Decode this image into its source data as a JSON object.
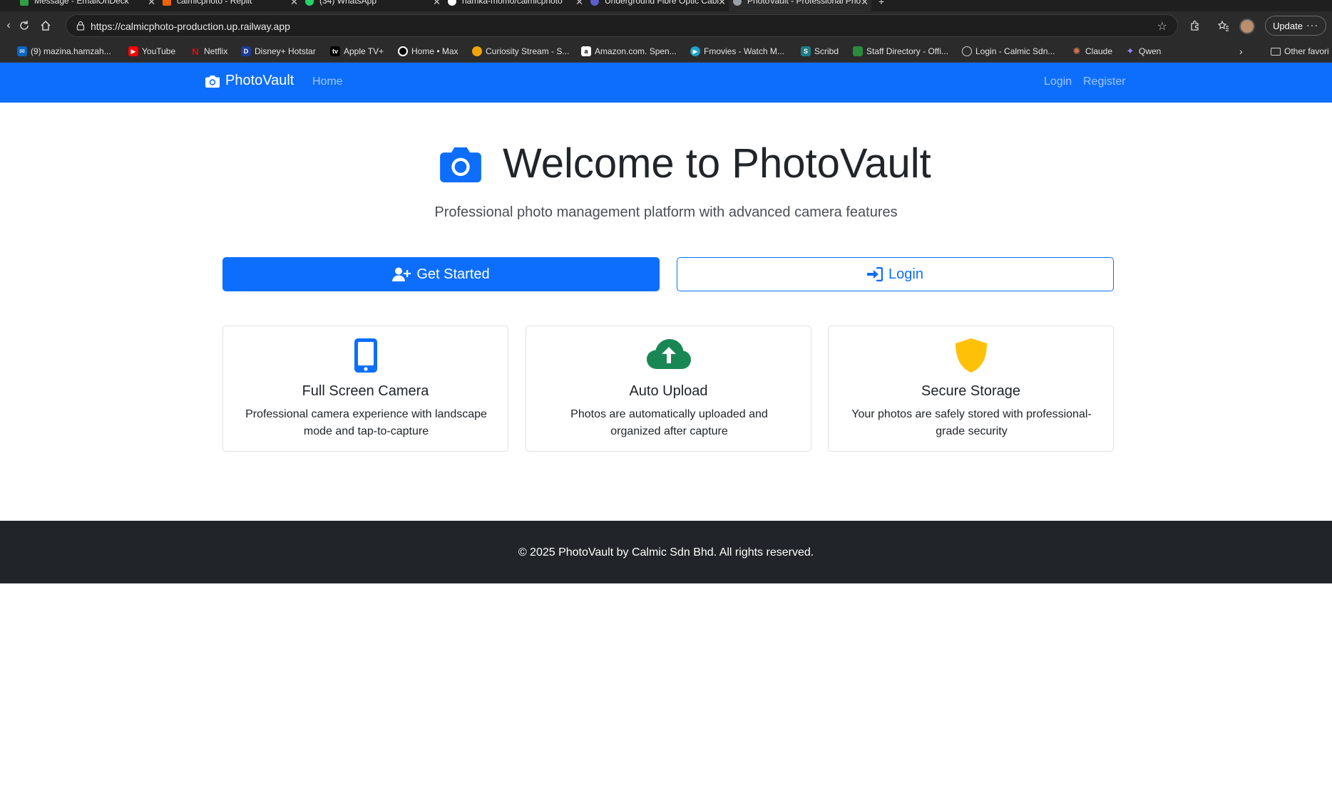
{
  "browser": {
    "tabs": [
      {
        "title": "Message - EmailOnDeck",
        "fav_color": "#2f9e44"
      },
      {
        "title": "calmicphoto - Replit",
        "fav_color": "#f26207"
      },
      {
        "title": "(34) WhatsApp",
        "fav_color": "#25d366"
      },
      {
        "title": "hamka-momo/calmicphoto",
        "fav_color": "#ffffff"
      },
      {
        "title": "Underground Fibre Optic Cable S",
        "fav_color": "#5b5fc7"
      },
      {
        "title": "PhotoVault - Professional Photo M",
        "fav_color": "#9aa0a6"
      }
    ],
    "url": "https://calmicphoto-production.up.railway.app",
    "update_label": "Update",
    "bookmarks": [
      {
        "label": "(9) mazina.hamzah...",
        "color": "#0a66c2"
      },
      {
        "label": "YouTube",
        "color": "#ff0000"
      },
      {
        "label": "Netflix",
        "color": "#e50914"
      },
      {
        "label": "Disney+ Hotstar",
        "color": "#1f3a93"
      },
      {
        "label": "Apple TV+",
        "color": "#000000"
      },
      {
        "label": "Home • Max",
        "color": "#000000"
      },
      {
        "label": "Curiosity Stream - S...",
        "color": "#f0a30a"
      },
      {
        "label": "Amazon.com. Spen...",
        "color": "#ffffff"
      },
      {
        "label": "Fmovies - Watch M...",
        "color": "#1ea0c9"
      },
      {
        "label": "Scribd",
        "color": "#1e7b85"
      },
      {
        "label": "Staff Directory - Offi...",
        "color": "#2d8a3e"
      },
      {
        "label": "Login - Calmic Sdn...",
        "color": "#9aa0a6"
      },
      {
        "label": "Claude",
        "color": "#d97757"
      },
      {
        "label": "Qwen",
        "color": "#615ced"
      }
    ],
    "other_bookmarks": "Other favori"
  },
  "nav": {
    "brand": "PhotoVault",
    "home": "Home",
    "login": "Login",
    "register": "Register"
  },
  "hero": {
    "title": "Welcome to PhotoVault",
    "lead": "Professional photo management platform with advanced camera features"
  },
  "actions": {
    "get_started": "Get Started",
    "login": "Login"
  },
  "features": [
    {
      "title": "Full Screen Camera",
      "text": "Professional camera experience with landscape mode and tap-to-capture",
      "icon": "phone-icon",
      "color": "#0d6efd"
    },
    {
      "title": "Auto Upload",
      "text": "Photos are automatically uploaded and organized after capture",
      "icon": "cloud-upload-icon",
      "color": "#198754"
    },
    {
      "title": "Secure Storage",
      "text": "Your photos are safely stored with professional-grade security",
      "icon": "shield-icon",
      "color": "#ffc107"
    }
  ],
  "footer": {
    "text": "© 2025 PhotoVault by Calmic Sdn Bhd. All rights reserved."
  }
}
